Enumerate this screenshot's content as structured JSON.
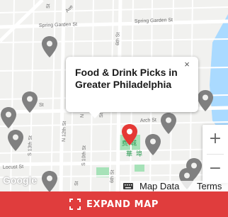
{
  "map": {
    "streets": {
      "spring_garden_west": "Spring Garden St",
      "spring_garden_east": "Spring Garden St",
      "sixth_north": "6th St",
      "ave_top": "Ave",
      "st_top": "St",
      "n_st": "N",
      "arch": "Arch St",
      "n_12th": "N 12th St",
      "n_13th": "S 13th St",
      "s_10th": "S 10th St",
      "locust": "Locust St",
      "sixth_south": "6th St",
      "st_bottom_a": "St",
      "st_bottom_b": "St",
      "st_left": "St",
      "st_mid": "St"
    },
    "chinese_labels": {
      "a": "费",
      "b": "城",
      "c": "華",
      "d": "埠"
    },
    "colors": {
      "pin": "#808080",
      "selected_pin": "#e53935",
      "accent": "#e03d3d",
      "park": "#a6e2b8"
    }
  },
  "popup": {
    "title": "Food & Drink Picks in Greater Philadelphia",
    "close_symbol": "×"
  },
  "zoom": {
    "in_label": "+",
    "out_label": "−"
  },
  "attribution": {
    "logo": "Google",
    "map_data": "Map Data",
    "terms": "Terms"
  },
  "expand_button": {
    "label": "EXPAND MAP",
    "icon": "expand-icon"
  }
}
